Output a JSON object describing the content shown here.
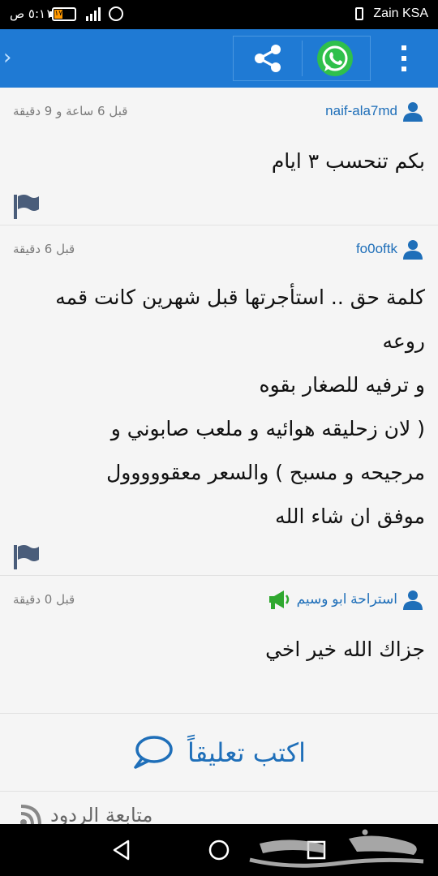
{
  "status_bar": {
    "carrier": "Zain KSA",
    "time": "٥:١١ ص",
    "battery_level": "١٧",
    "battery_fraction": 0.17
  },
  "toolbar": {
    "back_icon": "chevron-left",
    "share_icon": "share-icon",
    "whatsapp_icon": "whatsapp-icon",
    "menu_icon": "more-vertical-icon",
    "bar_color": "#1f7ad4",
    "whatsapp_color": "#2fc04b"
  },
  "comments": [
    {
      "username": "naif-ala7md",
      "time": "قبل 6 ساعة و 9 دقيقة",
      "lines": [
        "بكم تنحسب ٣ ايام"
      ]
    },
    {
      "username": "fo0oftk",
      "time": "قبل 6 دقيقة",
      "lines": [
        "كلمة حق .. استأجرتها قبل شهرين كانت قمه",
        "روعه",
        "و ترفيه للصغار بقوه",
        "( لان زحليقه هوائيه و ملعب صابوني و",
        "مرجيحه و مسبح ) والسعر معقووووول",
        "موفق ان شاء الله"
      ]
    },
    {
      "username": "استراحة ابو وسيم",
      "time": "قبل 0 دقيقة",
      "lines": [
        "جزاك الله خير اخي"
      ],
      "advertiser_badge": "megaphone-icon",
      "badge_color": "#2fa82f"
    }
  ],
  "write_comment": {
    "label": "اكتب تعليقاً"
  },
  "follow": {
    "label": "متابعة الردود"
  },
  "watermark": {
    "text": "حراج"
  },
  "accent_color": "#1f6fb9"
}
